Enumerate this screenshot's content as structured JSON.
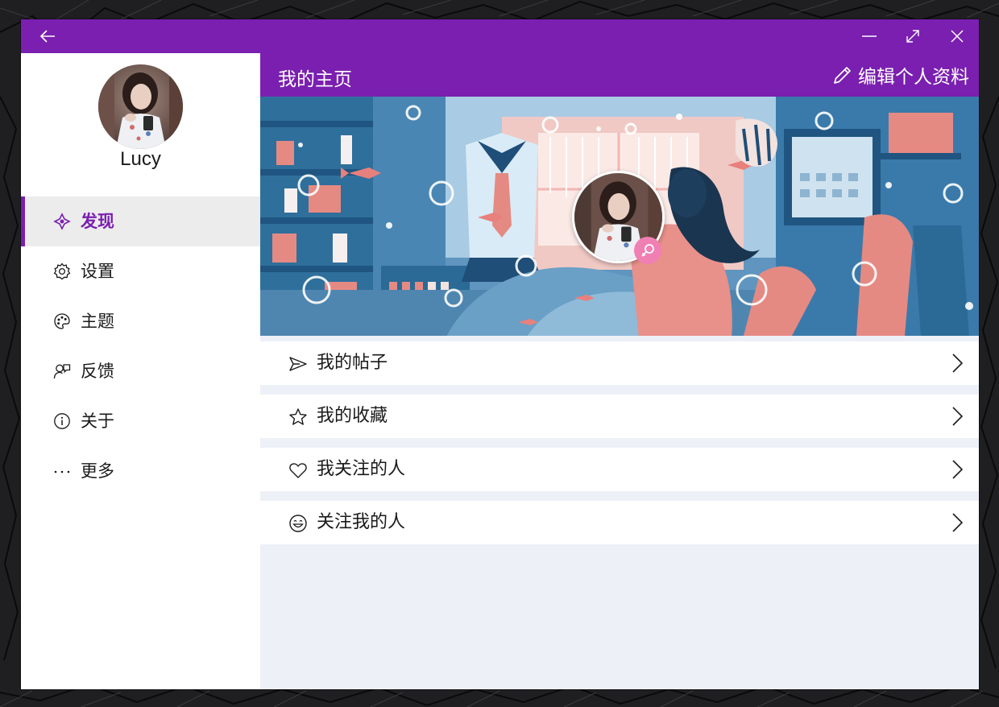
{
  "window": {
    "accent_color": "#7a1fb0",
    "back_icon": "arrow-left-icon",
    "controls": [
      "minimize-icon",
      "maximize-icon",
      "close-icon"
    ]
  },
  "sidebar": {
    "user_name": "Lucy",
    "items": [
      {
        "label": "发现",
        "icon": "compass-icon",
        "active": true
      },
      {
        "label": "设置",
        "icon": "gear-icon",
        "active": false
      },
      {
        "label": "主题",
        "icon": "palette-icon",
        "active": false
      },
      {
        "label": "反馈",
        "icon": "feedback-icon",
        "active": false
      },
      {
        "label": "关于",
        "icon": "info-icon",
        "active": false
      },
      {
        "label": "更多",
        "icon": "more-icon",
        "active": false
      }
    ]
  },
  "main": {
    "title": "我的主页",
    "edit_label": "编辑个人资料",
    "gender_icon": "female-icon",
    "list": [
      {
        "label": "我的帖子",
        "icon": "send-icon"
      },
      {
        "label": "我的收藏",
        "icon": "star-icon"
      },
      {
        "label": "我关注的人",
        "icon": "heart-icon"
      },
      {
        "label": "关注我的人",
        "icon": "smile-icon"
      }
    ]
  }
}
